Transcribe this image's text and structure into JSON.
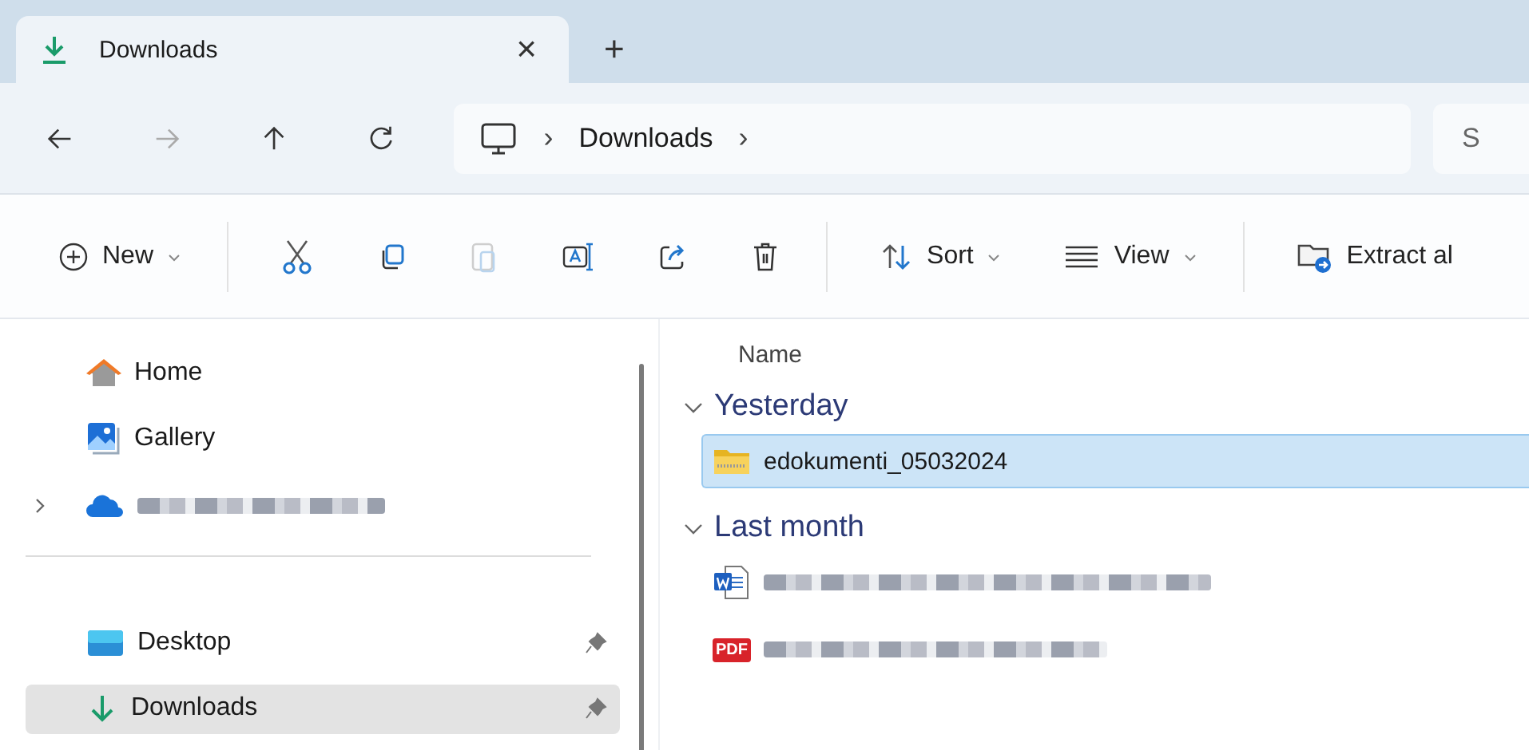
{
  "tabs": [
    {
      "title": "Downloads",
      "selected": true,
      "close": "×"
    }
  ],
  "new_tab": "+",
  "address": {
    "crumbs": [
      "Downloads"
    ],
    "separator": "›"
  },
  "search": {
    "placeholder": "S"
  },
  "toolbar": [
    {
      "kind": "new",
      "label": "New",
      "disabled": false
    },
    {
      "kind": "cut",
      "disabled": false
    },
    {
      "kind": "copy",
      "disabled": false
    },
    {
      "kind": "paste",
      "disabled": true
    },
    {
      "kind": "rename",
      "disabled": false
    },
    {
      "kind": "share",
      "disabled": false
    },
    {
      "kind": "delete",
      "disabled": false
    },
    {
      "kind": "sort",
      "label": "Sort",
      "disabled": false
    },
    {
      "kind": "view",
      "label": "View",
      "disabled": false
    },
    {
      "kind": "extract",
      "label": "Extract al",
      "disabled": false
    }
  ],
  "sidebar": {
    "items": [
      {
        "kind": "home",
        "label": "Home",
        "selected": false
      },
      {
        "kind": "gallery",
        "label": "Gallery",
        "selected": false
      },
      {
        "kind": "cloud",
        "redacted": true,
        "expanded": false,
        "selected": false
      },
      {
        "kind": "divider"
      },
      {
        "kind": "desktop",
        "label": "Desktop",
        "selected": false,
        "pinned": true
      },
      {
        "kind": "downloads",
        "label": "Downloads",
        "selected": true,
        "pinned": true
      }
    ]
  },
  "list": {
    "column": "Name",
    "groups": [
      {
        "title": "Yesterday",
        "expanded": true,
        "files": [
          {
            "kind": "zip",
            "name": "edokumenti_05032024",
            "selected": true
          }
        ]
      },
      {
        "title": "Last month",
        "expanded": true,
        "files": [
          {
            "kind": "word",
            "redacted": true,
            "selected": false
          },
          {
            "kind": "pdf",
            "badge": "PDF",
            "redacted": true,
            "selected": false
          }
        ]
      }
    ]
  }
}
